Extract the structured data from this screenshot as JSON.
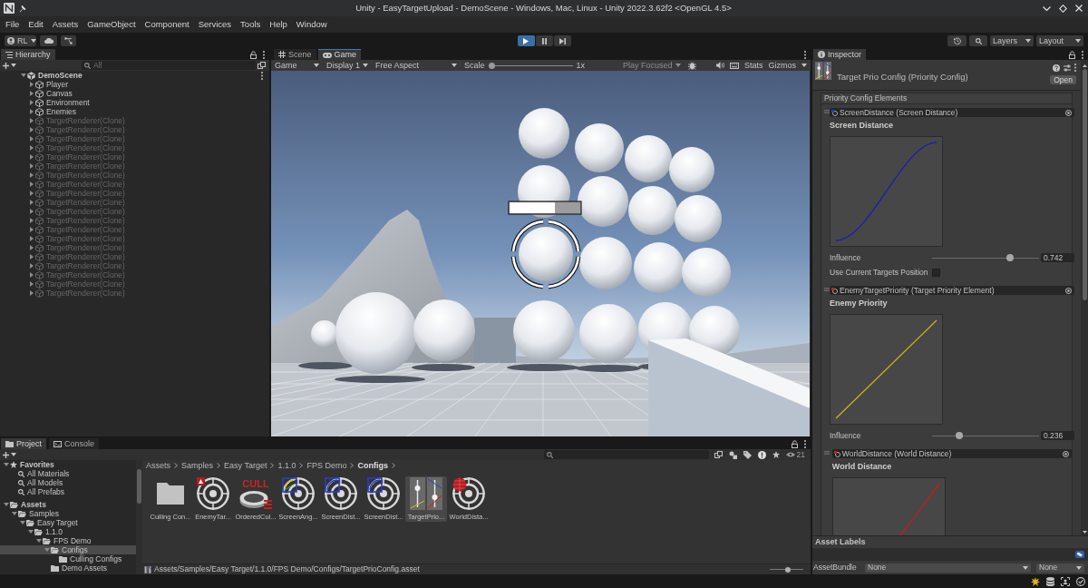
{
  "window": {
    "title": "Unity - EasyTargetUpload - DemoScene - Windows, Mac, Linux - Unity 2022.3.62f2 <OpenGL 4.5>"
  },
  "menu": [
    "File",
    "Edit",
    "Assets",
    "GameObject",
    "Component",
    "Services",
    "Tools",
    "Help",
    "Window"
  ],
  "toolbar": {
    "account": "RL",
    "play_controls": [
      {
        "kind": "play",
        "selected": true
      },
      {
        "kind": "pause",
        "selected": false
      },
      {
        "kind": "step",
        "selected": false
      }
    ],
    "layers": "Layers",
    "layout": "Layout"
  },
  "hierarchy": {
    "tab": "Hierarchy",
    "search": {
      "placeholder": "All"
    },
    "tree": [
      {
        "label": "DemoScene",
        "kind": "scene",
        "active": true,
        "expanded": true,
        "children": [
          {
            "label": "Player",
            "kind": "object",
            "active": true,
            "expanded": false
          },
          {
            "label": "Canvas",
            "kind": "object",
            "active": true,
            "expanded": false
          },
          {
            "label": "Environment",
            "kind": "object",
            "active": true,
            "expanded": false
          },
          {
            "label": "Enemies",
            "kind": "object",
            "active": true,
            "expanded": false
          },
          {
            "label": "TargetRenderer(Clone)",
            "kind": "object",
            "active": false,
            "expanded": false
          },
          {
            "label": "TargetRenderer(Clone)",
            "kind": "object",
            "active": false,
            "expanded": false
          },
          {
            "label": "TargetRenderer(Clone)",
            "kind": "object",
            "active": false,
            "expanded": false
          },
          {
            "label": "TargetRenderer(Clone)",
            "kind": "object",
            "active": false,
            "expanded": false
          },
          {
            "label": "TargetRenderer(Clone)",
            "kind": "object",
            "active": false,
            "expanded": false
          },
          {
            "label": "TargetRenderer(Clone)",
            "kind": "object",
            "active": false,
            "expanded": false
          },
          {
            "label": "TargetRenderer(Clone)",
            "kind": "object",
            "active": false,
            "expanded": false
          },
          {
            "label": "TargetRenderer(Clone)",
            "kind": "object",
            "active": false,
            "expanded": false
          },
          {
            "label": "TargetRenderer(Clone)",
            "kind": "object",
            "active": false,
            "expanded": false
          },
          {
            "label": "TargetRenderer(Clone)",
            "kind": "object",
            "active": false,
            "expanded": false
          },
          {
            "label": "TargetRenderer(Clone)",
            "kind": "object",
            "active": false,
            "expanded": false
          },
          {
            "label": "TargetRenderer(Clone)",
            "kind": "object",
            "active": false,
            "expanded": false
          },
          {
            "label": "TargetRenderer(Clone)",
            "kind": "object",
            "active": false,
            "expanded": false
          },
          {
            "label": "TargetRenderer(Clone)",
            "kind": "object",
            "active": false,
            "expanded": false
          },
          {
            "label": "TargetRenderer(Clone)",
            "kind": "object",
            "active": false,
            "expanded": false
          },
          {
            "label": "TargetRenderer(Clone)",
            "kind": "object",
            "active": false,
            "expanded": false
          },
          {
            "label": "TargetRenderer(Clone)",
            "kind": "object",
            "active": false,
            "expanded": false
          },
          {
            "label": "TargetRenderer(Clone)",
            "kind": "object",
            "active": false,
            "expanded": false
          },
          {
            "label": "TargetRenderer(Clone)",
            "kind": "object",
            "active": false,
            "expanded": false
          },
          {
            "label": "TargetRenderer(Clone)",
            "kind": "object",
            "active": false,
            "expanded": false
          }
        ]
      }
    ]
  },
  "game_view": {
    "tabs": [
      {
        "label": "Scene",
        "kind": "scene",
        "selected": false
      },
      {
        "label": "Game",
        "kind": "game",
        "selected": true
      }
    ],
    "toolbar": {
      "view": "Game",
      "display": "Display 1",
      "aspect": "Free Aspect",
      "scale": {
        "label": "Scale",
        "level": 0,
        "value": "1x"
      },
      "play_mode": {
        "label": "Play Focused",
        "disabled": true
      },
      "stats": "Stats",
      "gizmos": "Gizmos"
    }
  },
  "inspector": {
    "tab": "Inspector",
    "title": "Target Prio Config (Priority Config)",
    "open_button": "Open",
    "list_title": "Priority Config Elements",
    "elements": [
      {
        "kind": "screen_distance",
        "header": "ScreenDistance (Screen Distance)",
        "title": "Screen Distance",
        "color": "#1c1cb4",
        "influence": {
          "label": "Influence",
          "level": 0.742,
          "value": "0.742"
        },
        "toggle": {
          "label": "Use Current Targets Position",
          "checked": false
        }
      },
      {
        "kind": "enemy_priority",
        "header": "EnemyTargetPriority (Target Priority Element)",
        "title": "Enemy Priority",
        "color": "#c8b414",
        "influence": {
          "label": "Influence",
          "level": 0.236,
          "value": "0.236"
        }
      },
      {
        "kind": "world_distance",
        "header": "WorldDistance (World Distance)",
        "title": "World Distance",
        "color": "#c41c1c"
      }
    ],
    "asset_labels": "Asset Labels",
    "asset_bundle": {
      "label": "AssetBundle",
      "name": "None",
      "variant": "None"
    }
  },
  "project": {
    "tabs": [
      {
        "label": "Project",
        "kind": "project",
        "selected": true
      },
      {
        "label": "Console",
        "kind": "console",
        "selected": false
      }
    ],
    "hidden_count": "21",
    "favorites": {
      "label": "Favorites",
      "expanded": true,
      "children": [
        {
          "label": "All Materials",
          "selected": false
        },
        {
          "label": "All Models",
          "selected": false
        },
        {
          "label": "All Prefabs",
          "selected": false
        }
      ]
    },
    "folders": [
      {
        "label": "Assets",
        "expanded": true,
        "selected": false,
        "children": [
          {
            "label": "Samples",
            "expanded": true,
            "selected": false,
            "children": [
              {
                "label": "Easy Target",
                "expanded": true,
                "selected": false,
                "children": [
                  {
                    "label": "1.1.0",
                    "expanded": true,
                    "selected": false,
                    "children": [
                      {
                        "label": "FPS Demo",
                        "expanded": true,
                        "selected": false,
                        "children": [
                          {
                            "label": "Configs",
                            "expanded": true,
                            "selected": true,
                            "children": [
                              {
                                "label": "Culling Configs",
                                "selected": false
                              }
                            ]
                          },
                          {
                            "label": "Demo Assets",
                            "selected": false
                          }
                        ]
                      }
                    ]
                  }
                ]
              }
            ]
          }
        ]
      }
    ],
    "breadcrumb": [
      {
        "label": "Assets",
        "current": false
      },
      {
        "label": "Samples",
        "current": false
      },
      {
        "label": "Easy Target",
        "current": false
      },
      {
        "label": "1.1.0",
        "current": false
      },
      {
        "label": "FPS Demo",
        "current": false
      },
      {
        "label": "Configs",
        "current": true
      }
    ],
    "items": [
      {
        "label": "Culling Con...",
        "kind": "folder",
        "selected": false
      },
      {
        "label": "EnemyTar...",
        "kind": "enemy_target",
        "selected": false
      },
      {
        "label": "OrderedCul...",
        "kind": "cull",
        "badge": "CULL",
        "selected": false
      },
      {
        "label": "ScreenAng...",
        "kind": "screen_angle",
        "selected": false
      },
      {
        "label": "ScreenDist...",
        "kind": "screen_distance",
        "selected": false
      },
      {
        "label": "ScreenDist...",
        "kind": "screen_distance",
        "selected": false
      },
      {
        "label": "TargetPrio...",
        "kind": "config",
        "selected": true
      },
      {
        "label": "WorldDista...",
        "kind": "world_distance",
        "selected": false
      }
    ],
    "path": "Assets/Samples/Easy Target/1.1.0/FPS Demo/Configs/TargetPrioConfig.asset",
    "icon_size": {
      "level": 0.55
    }
  }
}
